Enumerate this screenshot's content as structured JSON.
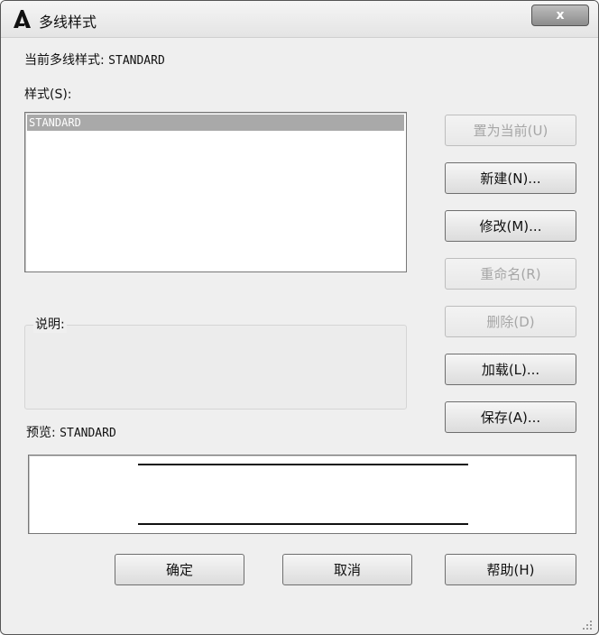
{
  "window": {
    "title": "多线样式",
    "close_label": "x"
  },
  "current_style": {
    "label": "当前多线样式:",
    "value": "STANDARD"
  },
  "styles_list": {
    "label": "样式(S):",
    "items": [
      "STANDARD"
    ],
    "selected_index": 0
  },
  "description": {
    "label": "说明:"
  },
  "preview": {
    "label": "预览:",
    "value": "STANDARD"
  },
  "side_buttons": [
    {
      "label": "置为当前(U)",
      "enabled": false
    },
    {
      "label": "新建(N)...",
      "enabled": true
    },
    {
      "label": "修改(M)...",
      "enabled": true
    },
    {
      "label": "重命名(R)",
      "enabled": false
    },
    {
      "label": "删除(D)",
      "enabled": false
    },
    {
      "label": "加载(L)...",
      "enabled": true
    },
    {
      "label": "保存(A)...",
      "enabled": true
    }
  ],
  "bottom_buttons": [
    {
      "label": "确定"
    },
    {
      "label": "取消"
    },
    {
      "label": "帮助(H)"
    }
  ],
  "icons": {
    "app": "autocad-a-icon",
    "close": "close-icon",
    "resize": "resize-grip-icon"
  }
}
